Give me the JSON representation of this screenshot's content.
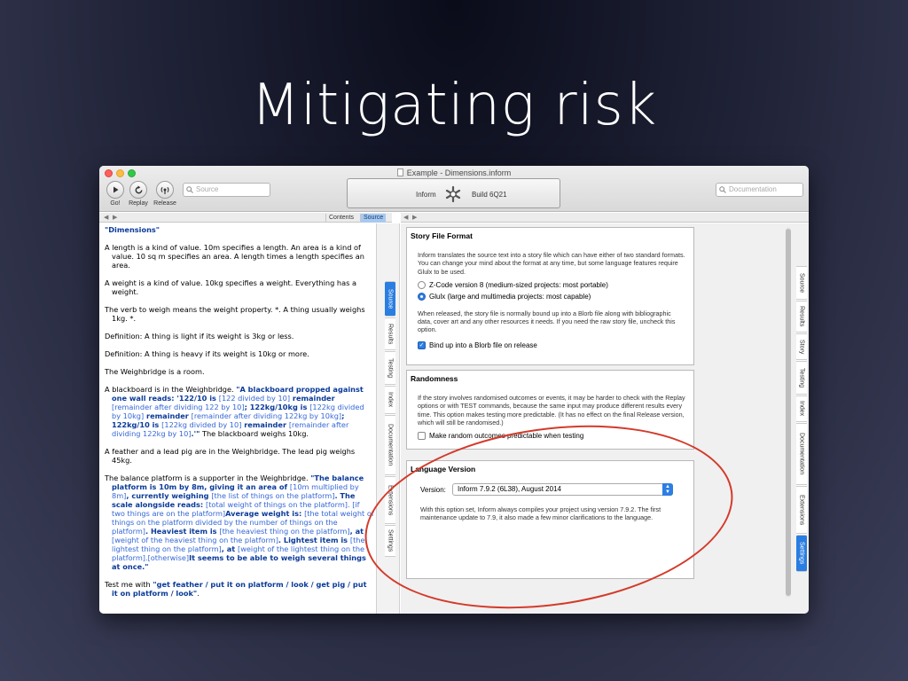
{
  "slide": {
    "title": "Mitigating risk"
  },
  "window": {
    "title": "Example - Dimensions.inform"
  },
  "toolbar": {
    "go_label": "Go!",
    "replay_label": "Replay",
    "release_label": "Release",
    "source_search_placeholder": "Source",
    "doc_search_placeholder": "Documentation"
  },
  "status": {
    "app": "Inform",
    "build": "Build 6Q21"
  },
  "left_nav": {
    "tabs": [
      "Contents",
      "Source"
    ]
  },
  "left_vtabs": [
    "Source",
    "Results",
    "Testing",
    "Index",
    "Documentation",
    "Extensions",
    "Settings"
  ],
  "right_vtabs": [
    "Source",
    "Results",
    "Story",
    "Testing",
    "Index",
    "Documentation",
    "Extensions",
    "Settings"
  ],
  "source": {
    "title": "\"Dimensions\"",
    "p1": "A length is a kind of value. 10m specifies a length. An area is a kind of value. 10 sq m specifies an area. A length times a length specifies an area.",
    "p2": "A weight is a kind of value. 10kg specifies a weight. Everything has a weight.",
    "p3": "The verb to weigh means the weight property. *. A thing usually weighs 1kg. *.",
    "p4": "Definition: A thing is light if its weight is 3kg or less.",
    "p5": "Definition: A thing is heavy if its weight is 10kg or more.",
    "p6": "The Weighbridge is a room.",
    "p7a": "A blackboard is in the Weighbridge. ",
    "p7b": "\"A blackboard propped against one wall reads: '122/10 is ",
    "p7c": "[122 divided by 10]",
    "p7d": " remainder ",
    "p7e": "[remainder after dividing 122 by 10]",
    "p7f": "; 122kg/10kg is ",
    "p7g": "[122kg divided by 10kg]",
    "p7h": " remainder ",
    "p7i": "[remainder after dividing 122kg by 10kg]",
    "p7j": "; 122kg/10 is ",
    "p7k": "[122kg divided by 10]",
    "p7l": " remainder ",
    "p7m": "[remainder after dividing 122kg by 10]",
    "p7n": ".'\"",
    "p7o": " The blackboard weighs 10kg.",
    "p8": "A feather and a lead pig are in the Weighbridge. The lead pig weighs 45kg.",
    "p9a": "The balance platform is a supporter in the Weighbridge. ",
    "p9b": "\"The balance platform is 10m by 8m, giving it an area of ",
    "p9c": "[10m multiplied by 8m]",
    "p9d": ", currently weighing ",
    "p9e": "[the list of things on the platform]",
    "p9f": ". The scale alongside reads: ",
    "p9g": "[total weight of things on the platform]. [if two things are on the platform]",
    "p9h": "Average weight is: ",
    "p9i": "[the total weight of things on the platform divided by the number of things on the platform]",
    "p9j": ". Heaviest item is ",
    "p9k": "[the heaviest thing on the platform]",
    "p9l": ", at ",
    "p9m": "[weight of the heaviest thing on the platform]",
    "p9n": ". Lightest item is ",
    "p9o": "[the lightest thing on the platform]",
    "p9p": ", at ",
    "p9q": "[weight of the lightest thing on the platform].[otherwise]",
    "p9r": "It seems to be able to weigh several things at once.\"",
    "p10a": "Test me with ",
    "p10b": "\"get feather / put it on platform / look / get pig / put it on platform / look\"",
    "p10c": "."
  },
  "settings": {
    "story_format": {
      "heading": "Story File Format",
      "intro": "Inform translates the source text into a story file which can have either of two standard formats. You can change your mind about the format at any time, but some language features require Glulx to be used.",
      "zcode": "Z-Code version 8 (medium-sized projects: most portable)",
      "glulx": "Glulx (large and multimedia projects: most capable)",
      "release_note": "When released, the story file is normally bound up into a Blorb file along with bibliographic data, cover art and any other resources it needs. If you need the raw story file, uncheck this option.",
      "blorb": "Bind up into a Blorb file on release"
    },
    "randomness": {
      "heading": "Randomness",
      "text": "If the story involves randomised outcomes or events, it may be harder to check with the Replay options or with TEST commands, because the same input may produce different results every time. This option makes testing more predictable. (It has no effect on the final Release version, which will still be randomised.)",
      "checkbox": "Make random outcomes predictable when testing"
    },
    "language": {
      "heading": "Language Version",
      "version_label": "Version:",
      "version_value": "Inform 7.9.2 (6L38), August 2014",
      "text": "With this option set, Inform always compiles your project using version 7.9.2. The first maintenance update to 7.9, it also made a few minor clarifications to the language."
    }
  },
  "colors": {
    "accent": "#2d7ee3",
    "annotation": "#d43a2a"
  }
}
